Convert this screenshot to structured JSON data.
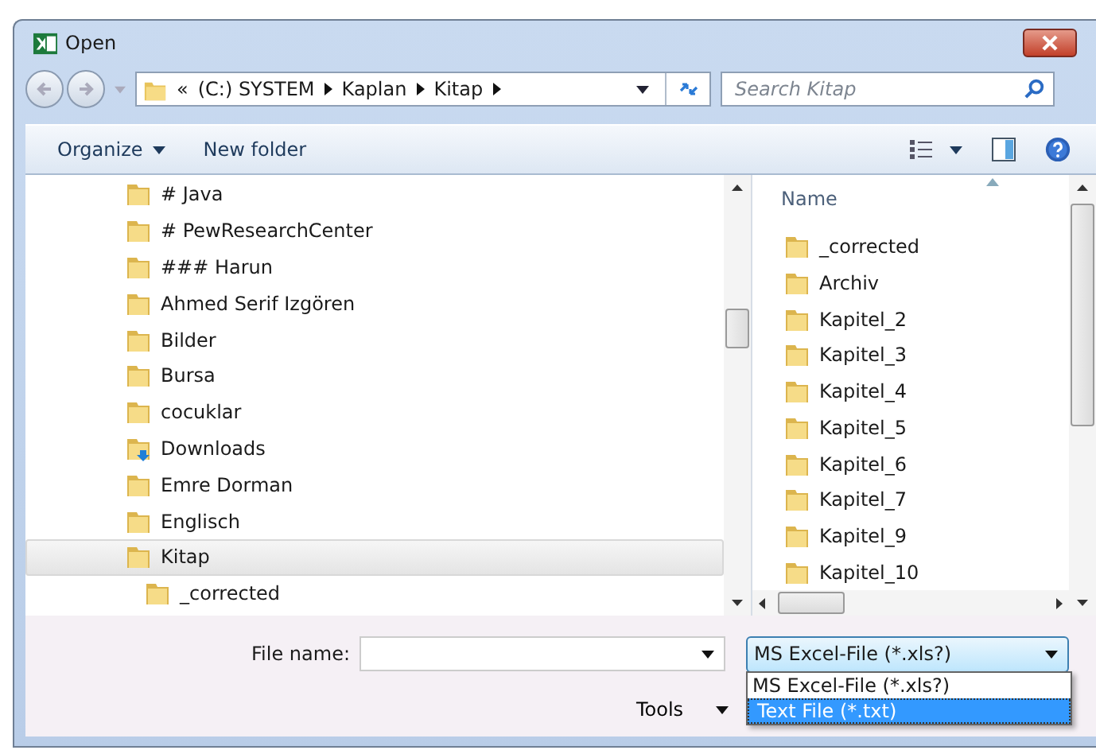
{
  "window": {
    "title": "Open"
  },
  "address": {
    "crumbs": [
      "«",
      "(C:) SYSTEM",
      "Kaplan",
      "Kitap"
    ]
  },
  "search": {
    "placeholder": "Search Kitap"
  },
  "toolbar": {
    "organize": "Organize",
    "new_folder": "New folder"
  },
  "tree": [
    {
      "label": "# Java",
      "kind": "folder",
      "selected": false
    },
    {
      "label": "# PewResearchCenter",
      "kind": "folder",
      "selected": false
    },
    {
      "label": "### Harun",
      "kind": "folder",
      "selected": false
    },
    {
      "label": "Ahmed Serif Izgören",
      "kind": "folder",
      "selected": false
    },
    {
      "label": "Bilder",
      "kind": "folder",
      "selected": false
    },
    {
      "label": "Bursa",
      "kind": "folder",
      "selected": false
    },
    {
      "label": "cocuklar",
      "kind": "folder",
      "selected": false
    },
    {
      "label": "Downloads",
      "kind": "downloads",
      "selected": false
    },
    {
      "label": "Emre Dorman",
      "kind": "folder",
      "selected": false
    },
    {
      "label": "Englisch",
      "kind": "folder",
      "selected": false
    },
    {
      "label": "Kitap",
      "kind": "folder",
      "selected": true,
      "children": [
        {
          "label": "_corrected",
          "kind": "folder",
          "selected": false
        }
      ]
    }
  ],
  "file_list": {
    "column": "Name",
    "items": [
      "_corrected",
      "Archiv",
      "Kapitel_2",
      "Kapitel_3",
      "Kapitel_4",
      "Kapitel_5",
      "Kapitel_6",
      "Kapitel_7",
      "Kapitel_9",
      "Kapitel_10"
    ]
  },
  "file_name": {
    "label": "File name:"
  },
  "file_type": {
    "value": "MS Excel-File (*.xls?)",
    "expanded": true,
    "options": [
      {
        "label": "MS Excel-File (*.xls?)",
        "highlighted": false
      },
      {
        "label": "Text File (*.txt)",
        "highlighted": true
      }
    ]
  },
  "tools": {
    "label": "Tools"
  }
}
